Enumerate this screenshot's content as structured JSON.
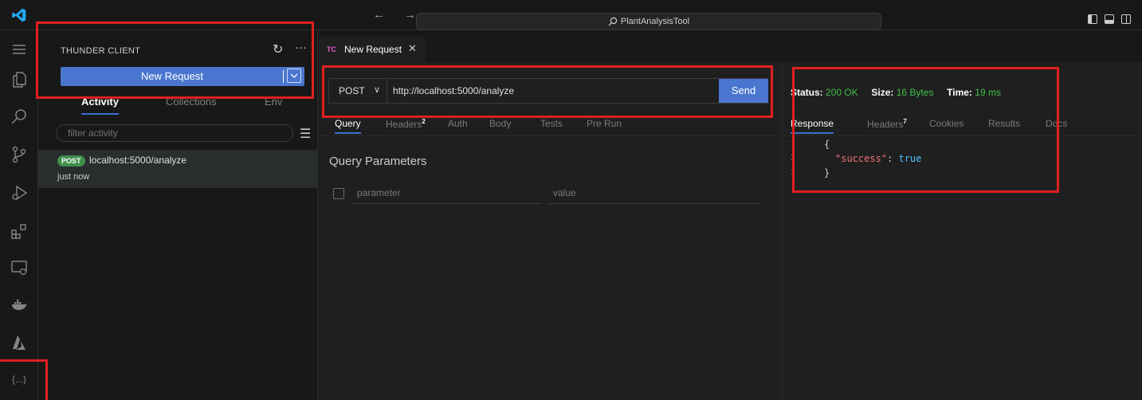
{
  "titlebar": {
    "search_text": "PlantAnalysisTool",
    "nav_arrows": "← →"
  },
  "sidebar": {
    "header": "THUNDER CLIENT",
    "new_request_label": "New Request",
    "tabs": [
      "Activity",
      "Collections",
      "Env"
    ],
    "filter_placeholder": "filter activity",
    "activity": [
      {
        "method": "POST",
        "url": "localhost:5000/analyze",
        "time": "just now"
      }
    ]
  },
  "editor_tab": {
    "badge": "TC",
    "title": "New Request",
    "close": "✕"
  },
  "request": {
    "method": "POST",
    "url": "http://localhost:5000/analyze",
    "send_label": "Send",
    "tabs": [
      "Query",
      "Headers",
      "Auth",
      "Body",
      "Tests",
      "Pre Run"
    ],
    "headers_count": "2",
    "query_title": "Query Parameters",
    "param_placeholder": "parameter",
    "value_placeholder": "value"
  },
  "response": {
    "status_label": "Status:",
    "status_value": "200 OK",
    "size_label": "Size:",
    "size_value": "16 Bytes",
    "time_label": "Time:",
    "time_value": "19 ms",
    "tabs": [
      "Response",
      "Headers",
      "Cookies",
      "Results",
      "Docs"
    ],
    "headers_count": "7",
    "code": [
      {
        "n": "1",
        "text": "{"
      },
      {
        "n": "2",
        "key": "\"success\"",
        "sep": ": ",
        "val": "true"
      },
      {
        "n": "3",
        "text": "}"
      }
    ]
  },
  "activitybar": {
    "bottom_label": "{...}"
  },
  "colors": {
    "accent": "#4a76cf",
    "status_green": "#3fbf4a",
    "annotation_red": "#e02020",
    "post_badge": "#3f8f4c"
  }
}
